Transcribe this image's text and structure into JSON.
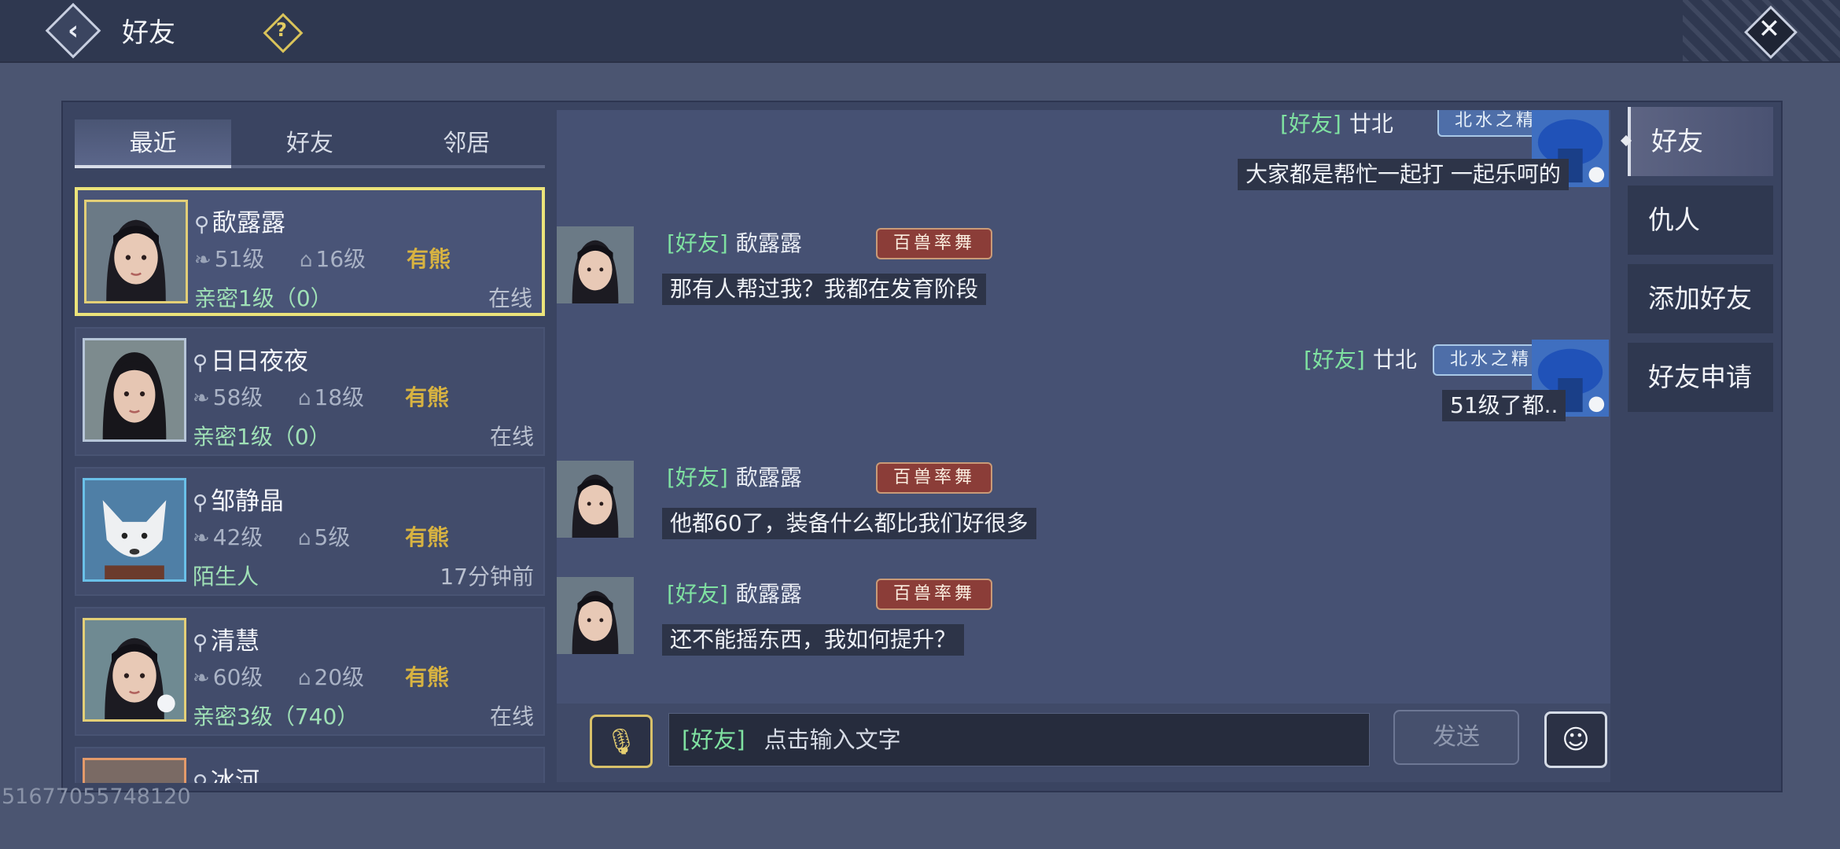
{
  "header": {
    "title": "好友",
    "back_icon": "back-arrow-icon",
    "help_label": "?",
    "close_label": "✕"
  },
  "tabs": [
    {
      "label": "最近",
      "active": true
    },
    {
      "label": "好友",
      "active": false
    },
    {
      "label": "邻居",
      "active": false
    }
  ],
  "friends": [
    {
      "name": "歃露露",
      "level": "51级",
      "house": "16级",
      "tag": "有熊",
      "intimacy": "亲密1级（0）",
      "status": "在线"
    },
    {
      "name": "日日夜夜",
      "level": "58级",
      "house": "18级",
      "tag": "有熊",
      "intimacy": "亲密1级（0）",
      "status": "在线"
    },
    {
      "name": "邹静晶",
      "level": "42级",
      "house": "5级",
      "tag": "有熊",
      "intimacy": "陌生人",
      "status": "17分钟前"
    },
    {
      "name": "清慧",
      "level": "60级",
      "house": "20级",
      "tag": "有熊",
      "intimacy": "亲密3级（740）",
      "status": "在线"
    },
    {
      "name": "冰河"
    }
  ],
  "chat": {
    "messages": [
      {
        "side": "right",
        "tag": "[好友]",
        "sender": "廿北",
        "badge": "北水之精",
        "text": "大家都是帮忙一起打 一起乐呵的"
      },
      {
        "side": "left",
        "tag": "[好友]",
        "sender": "歃露露",
        "badge": "百兽率舞",
        "text": "那有人帮过我？我都在发育阶段"
      },
      {
        "side": "right",
        "tag": "[好友]",
        "sender": "廿北",
        "badge": "北水之精",
        "text": "51级了都.."
      },
      {
        "side": "left",
        "tag": "[好友]",
        "sender": "歃露露",
        "badge": "百兽率舞",
        "text": "他都60了，装备什么都比我们好很多"
      },
      {
        "side": "left",
        "tag": "[好友]",
        "sender": "歃露露",
        "badge": "百兽率舞",
        "text": "还不能摇东西，我如何提升？"
      }
    ],
    "input": {
      "tag": "[好友]",
      "placeholder": "点击输入文字",
      "send_label": "发送",
      "voice_icon": "microphone-icon",
      "emoji_icon": "emoji-icon"
    }
  },
  "side_menu": [
    {
      "label": "好友",
      "active": true
    },
    {
      "label": "仇人",
      "active": false
    },
    {
      "label": "添加好友",
      "active": false
    },
    {
      "label": "好友申请",
      "active": false
    }
  ],
  "footer": {
    "uid": "51677055748120"
  },
  "colors": {
    "friend_tag": "#7fe1a1",
    "guild_tag": "#d8b341",
    "selected_border": "#ece47a",
    "background": "#4b5571"
  }
}
